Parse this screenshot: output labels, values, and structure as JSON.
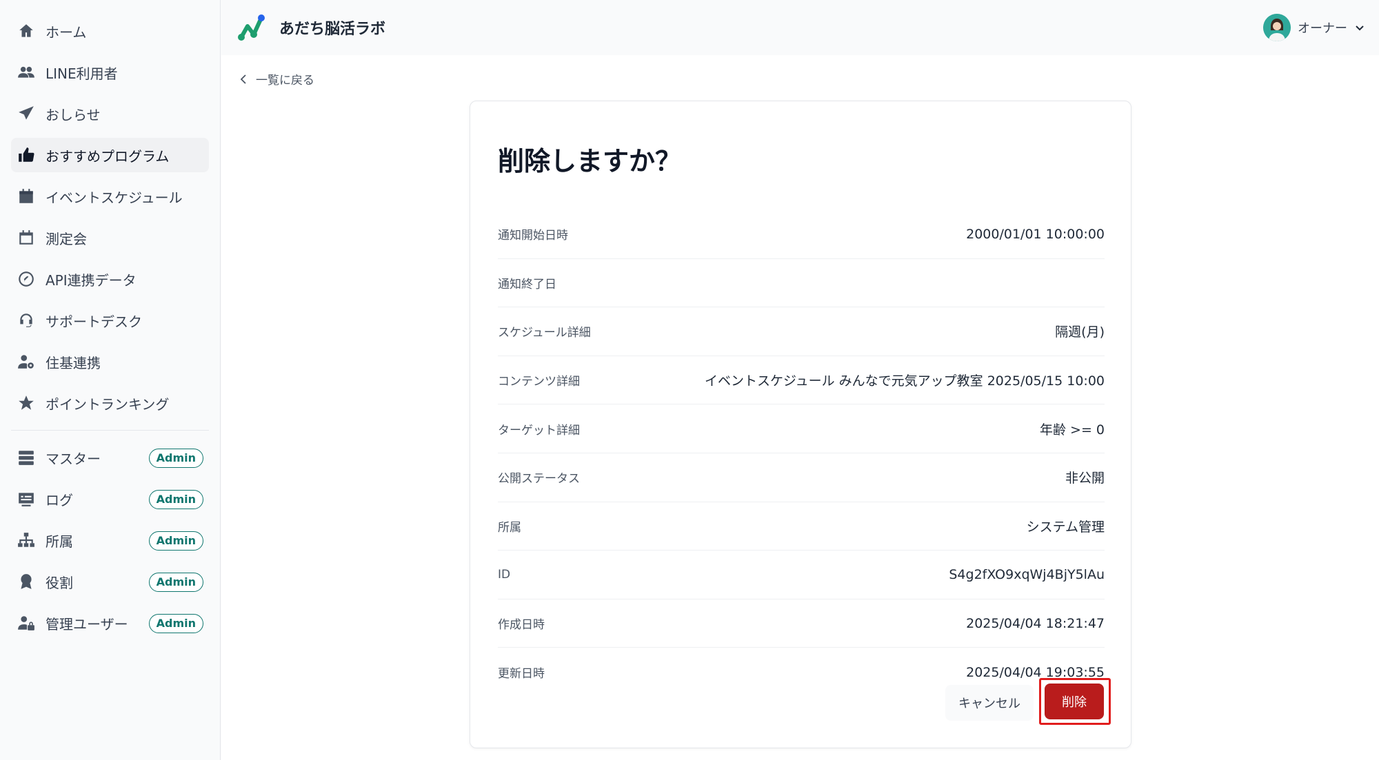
{
  "app": {
    "title": "あだち脳活ラボ"
  },
  "user": {
    "name": "オーナー"
  },
  "sidebar": {
    "items": [
      {
        "label": "ホーム",
        "icon": "home-icon"
      },
      {
        "label": "LINE利用者",
        "icon": "users-icon"
      },
      {
        "label": "おしらせ",
        "icon": "send-icon"
      },
      {
        "label": "おすすめプログラム",
        "icon": "thumbs-up-icon",
        "active": true
      },
      {
        "label": "イベントスケジュール",
        "icon": "calendar-icon"
      },
      {
        "label": "測定会",
        "icon": "calendar-outline-icon"
      },
      {
        "label": "API連携データ",
        "icon": "api-icon"
      },
      {
        "label": "サポートデスク",
        "icon": "headset-icon"
      },
      {
        "label": "住基連携",
        "icon": "user-gear-icon"
      },
      {
        "label": "ポイントランキング",
        "icon": "star-icon"
      }
    ],
    "admin_items": [
      {
        "label": "マスター",
        "icon": "database-icon",
        "badge": "Admin"
      },
      {
        "label": "ログ",
        "icon": "log-icon",
        "badge": "Admin"
      },
      {
        "label": "所属",
        "icon": "sitemap-icon",
        "badge": "Admin"
      },
      {
        "label": "役割",
        "icon": "award-icon",
        "badge": "Admin"
      },
      {
        "label": "管理ユーザー",
        "icon": "user-lock-icon",
        "badge": "Admin"
      }
    ]
  },
  "main": {
    "back_label": "一覧に戻る",
    "dialog": {
      "title": "削除しますか？",
      "rows": [
        {
          "label": "通知開始日時",
          "value": "2000/01/01 10:00:00"
        },
        {
          "label": "通知終了日",
          "value": ""
        },
        {
          "label": "スケジュール詳細",
          "value": "隔週(月)"
        },
        {
          "label": "コンテンツ詳細",
          "value": "イベントスケジュール みんなで元気アップ教室 2025/05/15 10:00"
        },
        {
          "label": "ターゲット詳細",
          "value": "年齢 >= 0"
        },
        {
          "label": "公開ステータス",
          "value": "非公開"
        },
        {
          "label": "所属",
          "value": "システム管理"
        },
        {
          "label": "ID",
          "value": "S4g2fXO9xqWj4BjY5lAu"
        },
        {
          "label": "作成日時",
          "value": "2025/04/04 18:21:47"
        },
        {
          "label": "更新日時",
          "value": "2025/04/04 19:03:55"
        }
      ],
      "cancel_label": "キャンセル",
      "delete_label": "削除"
    }
  },
  "colors": {
    "accent": "#0f766e",
    "danger": "#b91c1c",
    "highlight": "#e11d1d"
  }
}
